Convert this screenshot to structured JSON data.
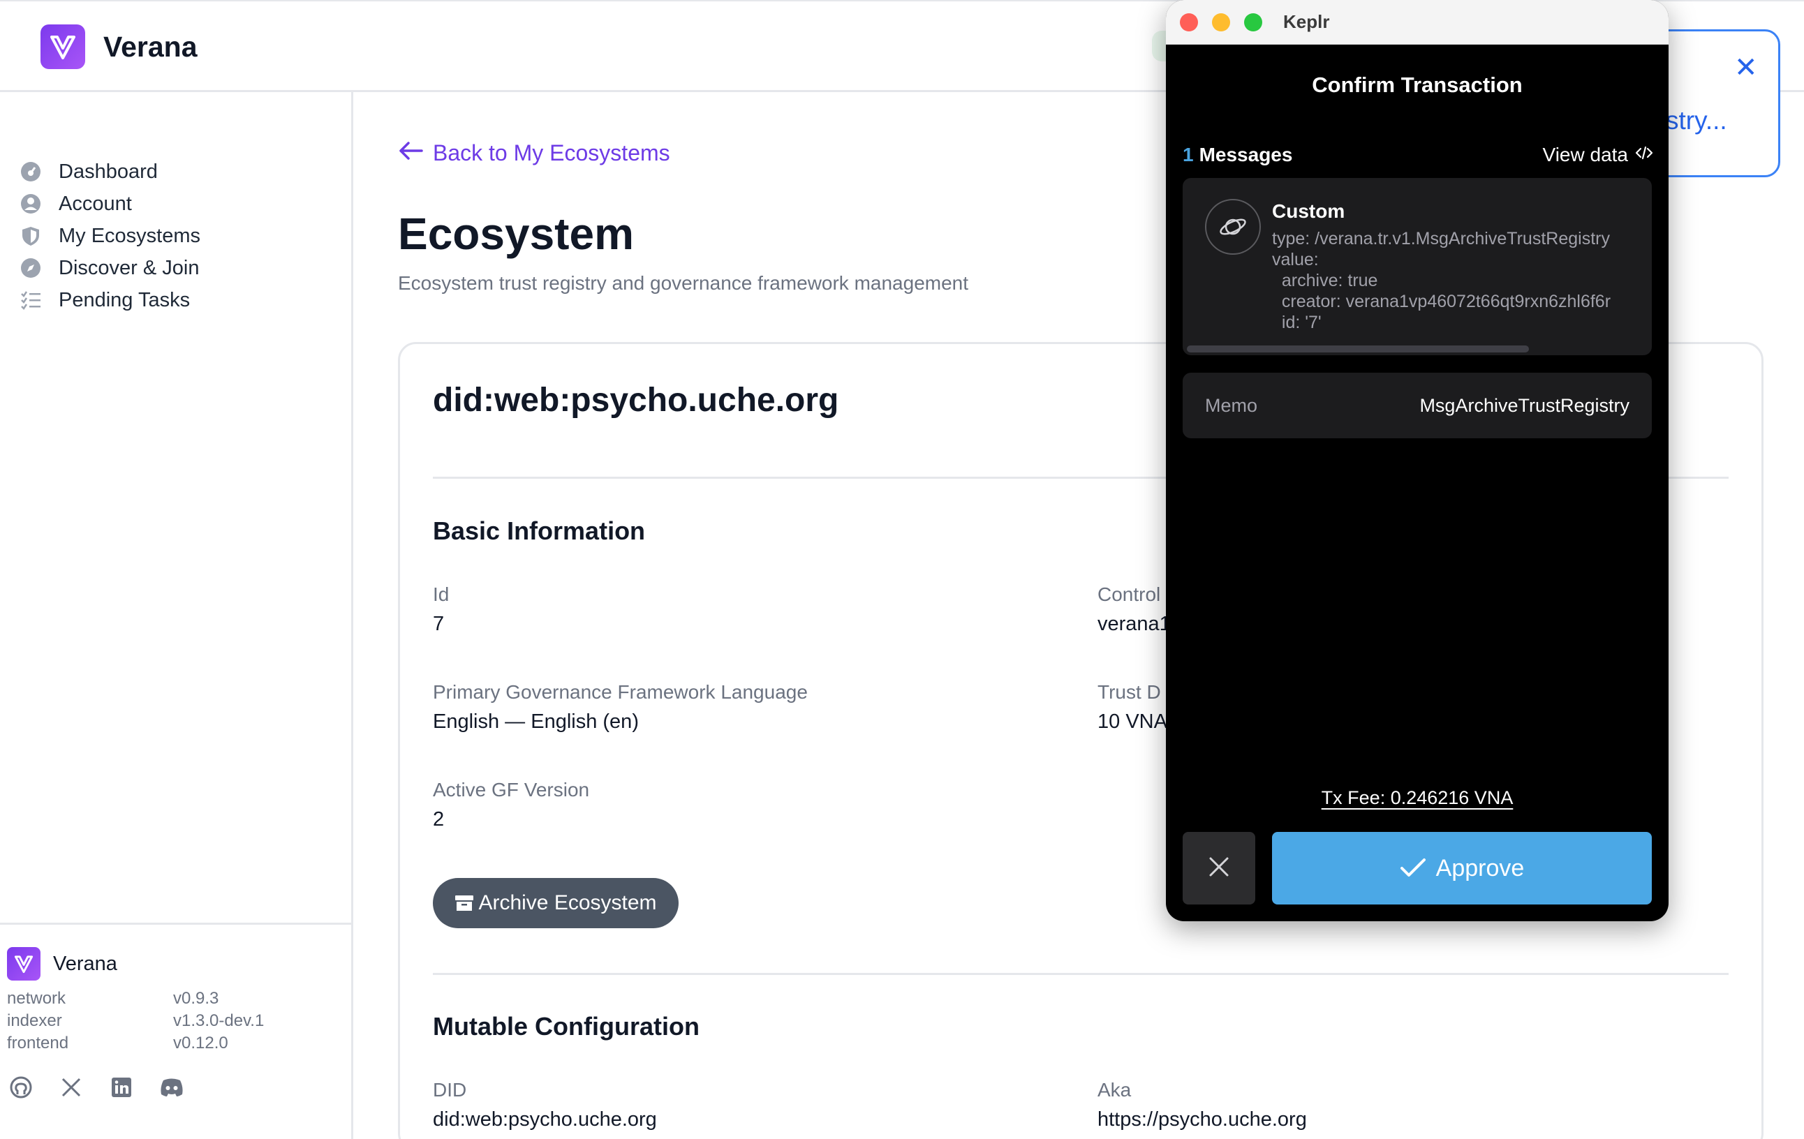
{
  "header": {
    "brand": "Verana"
  },
  "sidebar": {
    "items": [
      {
        "label": "Dashboard",
        "icon": "dashboard-icon"
      },
      {
        "label": "Account",
        "icon": "user-circle-icon"
      },
      {
        "label": "My Ecosystems",
        "icon": "shield-icon"
      },
      {
        "label": "Discover & Join",
        "icon": "compass-icon"
      },
      {
        "label": "Pending Tasks",
        "icon": "task-list-icon"
      }
    ],
    "footer": {
      "brand": "Verana",
      "versions": [
        {
          "key": "network",
          "value": "v0.9.3"
        },
        {
          "key": "indexer",
          "value": "v1.3.0-dev.1"
        },
        {
          "key": "frontend",
          "value": "v0.12.0"
        }
      ],
      "social": [
        "github-icon",
        "x-icon",
        "linkedin-icon",
        "discord-icon"
      ]
    }
  },
  "main": {
    "back_link": "Back to My Ecosystems",
    "title": "Ecosystem",
    "subtitle": "Ecosystem trust registry and governance framework management",
    "did": "did:web:psycho.uche.org",
    "basic": {
      "title": "Basic Information",
      "id_label": "Id",
      "id_value": "7",
      "controller_label": "Control",
      "controller_value": "verana1",
      "lang_label": "Primary Governance Framework Language",
      "lang_value": "English — English (en)",
      "deposit_label": "Trust D",
      "deposit_value": "10 VNA",
      "gf_label": "Active GF Version",
      "gf_value": "2",
      "archive_button": "Archive Ecosystem"
    },
    "mutable": {
      "title": "Mutable Configuration",
      "did_label": "DID",
      "did_value": "did:web:psycho.uche.org",
      "aka_label": "Aka",
      "aka_value": "https://psycho.uche.org"
    }
  },
  "toast": {
    "text": "stry..."
  },
  "keplr": {
    "window_title": "Keplr",
    "header": "Confirm Transaction",
    "messages_count": "1",
    "messages_label": "Messages",
    "view_data": "View data",
    "message": {
      "title": "Custom",
      "lines": [
        "type: /verana.tr.v1.MsgArchiveTrustRegistry",
        "value:",
        "  archive: true",
        "  creator: verana1vp46072t66qt9rxn6zhl6f6r",
        "  id: '7'"
      ]
    },
    "memo_label": "Memo",
    "memo_value": "MsgArchiveTrustRegistry",
    "fee": "Tx Fee: 0.246216 VNA",
    "approve": "Approve"
  },
  "colors": {
    "accent": "#6d3be6",
    "approve": "#4ba8e6",
    "toast": "#2563eb"
  }
}
